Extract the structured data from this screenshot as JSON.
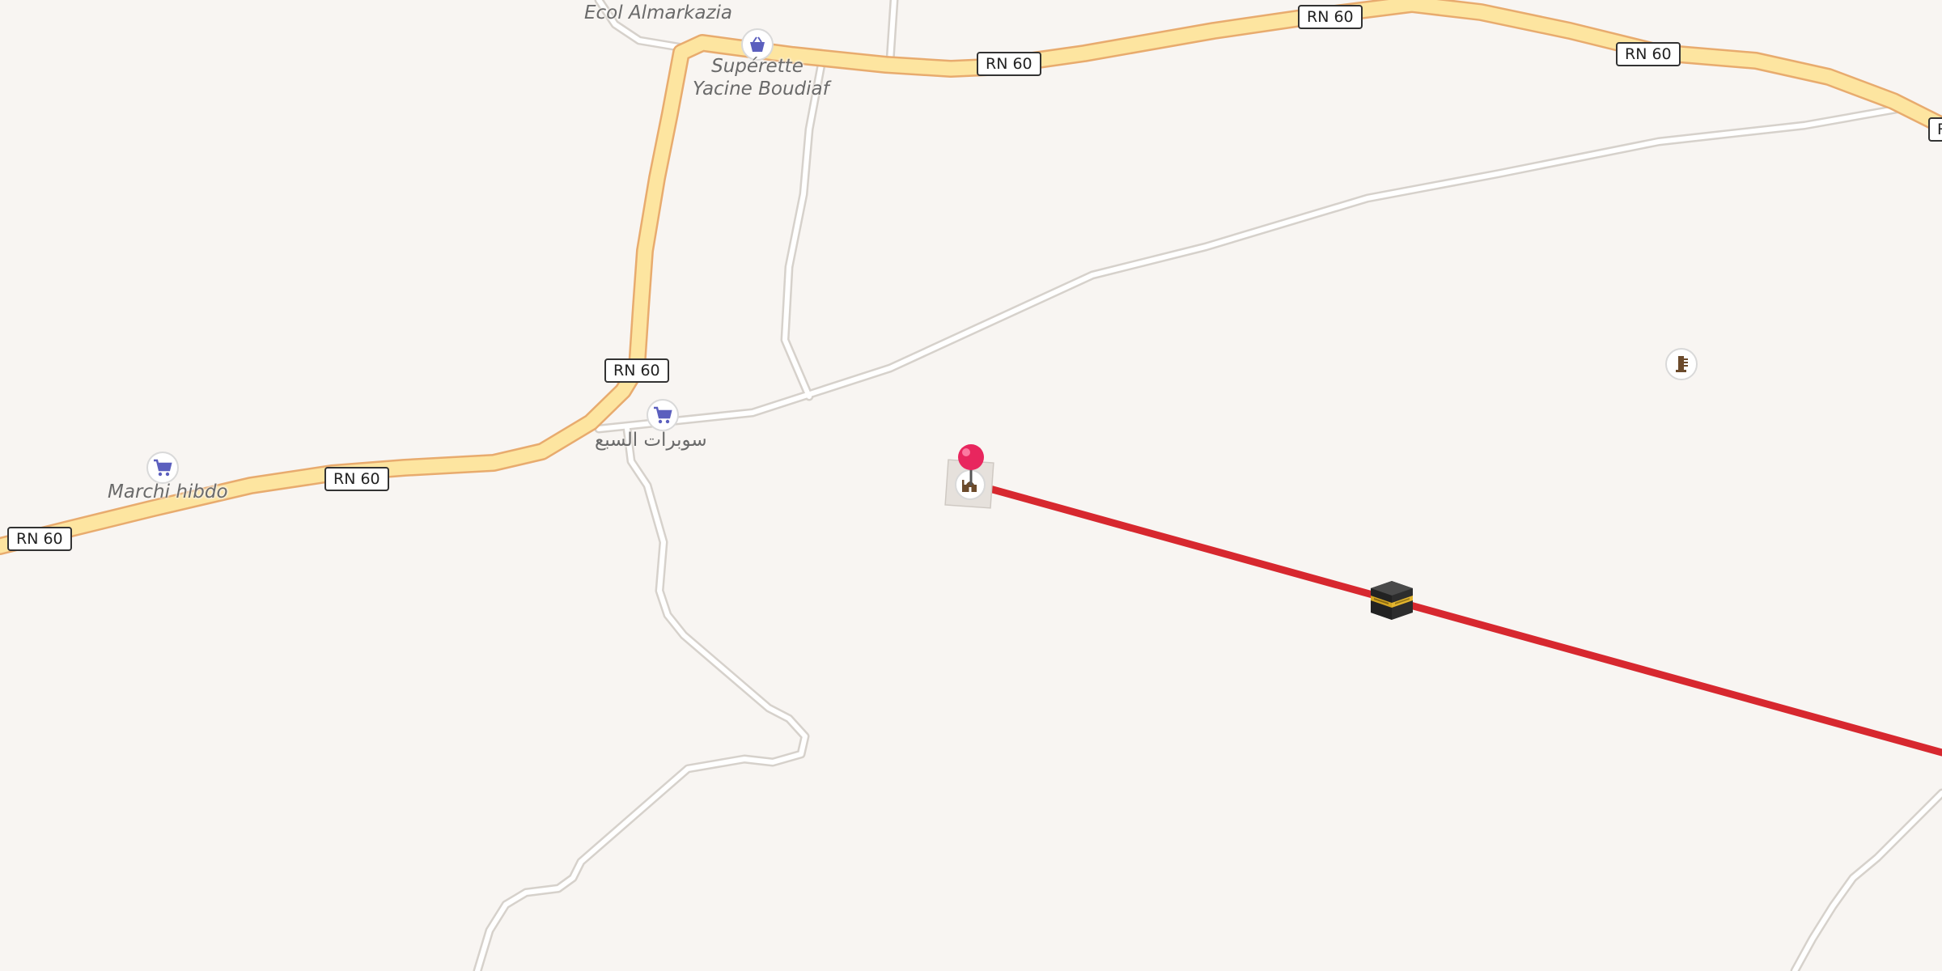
{
  "map": {
    "route_color": "#d7282f",
    "pin_color": "#e8265e",
    "major_road_color": "#fde5a0",
    "major_road_casing": "#e8ab6e",
    "minor_road_color": "#ffffff",
    "minor_road_casing": "#d6d1cb",
    "background_color": "#f8f5f2"
  },
  "road_shields": {
    "rn60_a": "RN 60",
    "rn60_b": "RN 60",
    "rn60_c": "RN 60",
    "rn60_d": "RN 60",
    "rn60_e": "RN 60",
    "rn60_f": "RN 60",
    "rn60_g": "R"
  },
  "pois": {
    "ecol_almarkazia": {
      "label": "Ecol Almarkazia"
    },
    "superette_line1": "Supérette",
    "superette_line2": "Yacine Boudiaf",
    "souk": {
      "label": "سوبرات السبع"
    },
    "marchi_hibdo": {
      "label": "Marchi hibdo"
    }
  },
  "icons": {
    "superette": "basket-icon",
    "souk": "shopping-cart-icon",
    "marchi": "shopping-cart-icon",
    "mosque": "mosque-icon",
    "kaaba": "kaaba-icon",
    "monument": "monument-icon",
    "pin": "location-pin-icon"
  }
}
